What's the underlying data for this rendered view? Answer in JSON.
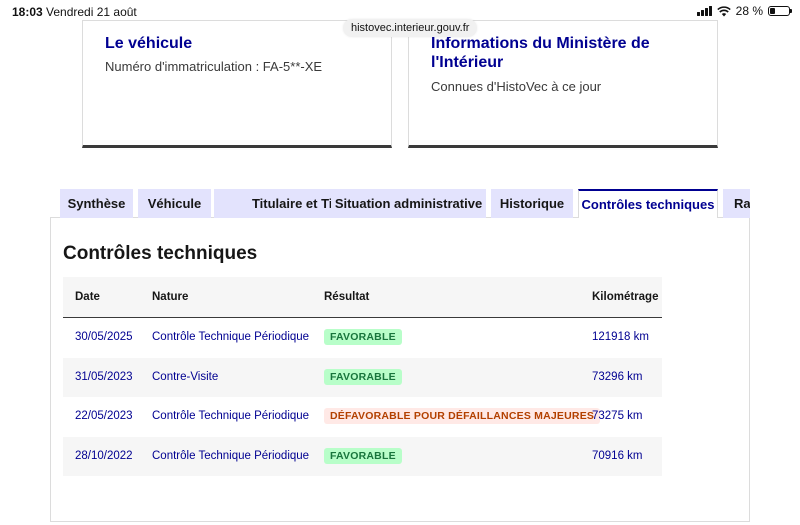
{
  "status_bar": {
    "time": "18:03",
    "date": "Vendredi 21 août",
    "battery": "28 %",
    "battery_level": 0.28
  },
  "browser": {
    "url": "histovec.interieur.gouv.fr"
  },
  "cards": {
    "left": {
      "title": "Le véhicule",
      "desc": "Numéro d'immatriculation : FA-5**-XE"
    },
    "right": {
      "title_line1": "Informations du Ministère de",
      "title_line2": "l'Intérieur",
      "desc": "Connues d'HistoVec à ce jour"
    }
  },
  "tabs": [
    {
      "label": "Synthèse"
    },
    {
      "label": "Véhicule"
    },
    {
      "label": "Titulaire et Titre"
    },
    {
      "label": "Situation administrative"
    },
    {
      "label": "Historique"
    },
    {
      "label": "Contrôles techniques"
    },
    {
      "label": "Rapport"
    }
  ],
  "active_tab": "Contrôles techniques",
  "panel": {
    "title": "Contrôles techniques",
    "columns": {
      "date": "Date",
      "nature": "Nature",
      "result": "Résultat",
      "km": "Kilométrage"
    },
    "rows": [
      {
        "date": "30/05/2025",
        "nature": "Contrôle Technique Périodique",
        "result": "FAVORABLE",
        "km": "121918 km"
      },
      {
        "date": "31/05/2023",
        "nature": "Contre-Visite",
        "result": "FAVORABLE",
        "km": "73296 km"
      },
      {
        "date": "22/05/2023",
        "nature": "Contrôle Technique Périodique",
        "result": "DÉFAVORABLE POUR DÉFAILLANCES MAJEURES",
        "km": "73275 km"
      },
      {
        "date": "28/10/2022",
        "nature": "Contrôle Technique Périodique",
        "result": "FAVORABLE",
        "km": "70916 km"
      }
    ]
  },
  "colors": {
    "primary": "#000091",
    "tab_bg": "#e3e3fd",
    "success_bg": "#b8fec9",
    "success_text": "#18753c",
    "error_bg": "#ffe9e6",
    "error_text": "#b34000"
  }
}
